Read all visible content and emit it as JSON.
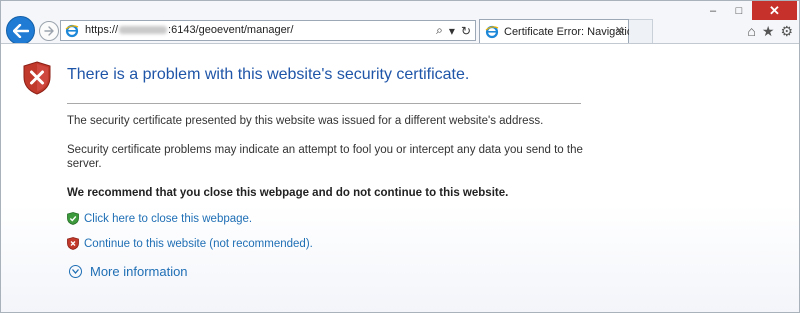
{
  "window": {
    "minimize_glyph": "–",
    "maximize_glyph": "□",
    "close_glyph": "✕"
  },
  "address_bar": {
    "url_prefix": "https://",
    "url_suffix": ":6143/geoevent/manager/",
    "search_glyph": "⌕",
    "dropdown_glyph": "▾",
    "refresh_glyph": "↻"
  },
  "tab": {
    "title": "Certificate Error: Navigation...",
    "close_glyph": "✕"
  },
  "toolbar_icons": {
    "home": "⌂",
    "favorites": "★",
    "settings": "⚙"
  },
  "page": {
    "heading": "There is a problem with this website's security certificate.",
    "para1": "The security certificate presented by this website was issued for a different website's address.",
    "para2": "Security certificate problems may indicate an attempt to fool you or intercept any data you send to the server.",
    "recommendation": "We recommend that you close this webpage and do not continue to this website.",
    "close_link": "Click here to close this webpage.",
    "continue_link": "Continue to this website (not recommended).",
    "more_info": "More information"
  },
  "colors": {
    "heading": "#1f55a8",
    "link": "#1f6fb5",
    "close_button": "#c7312b",
    "back_button": "#1f7bd3"
  }
}
